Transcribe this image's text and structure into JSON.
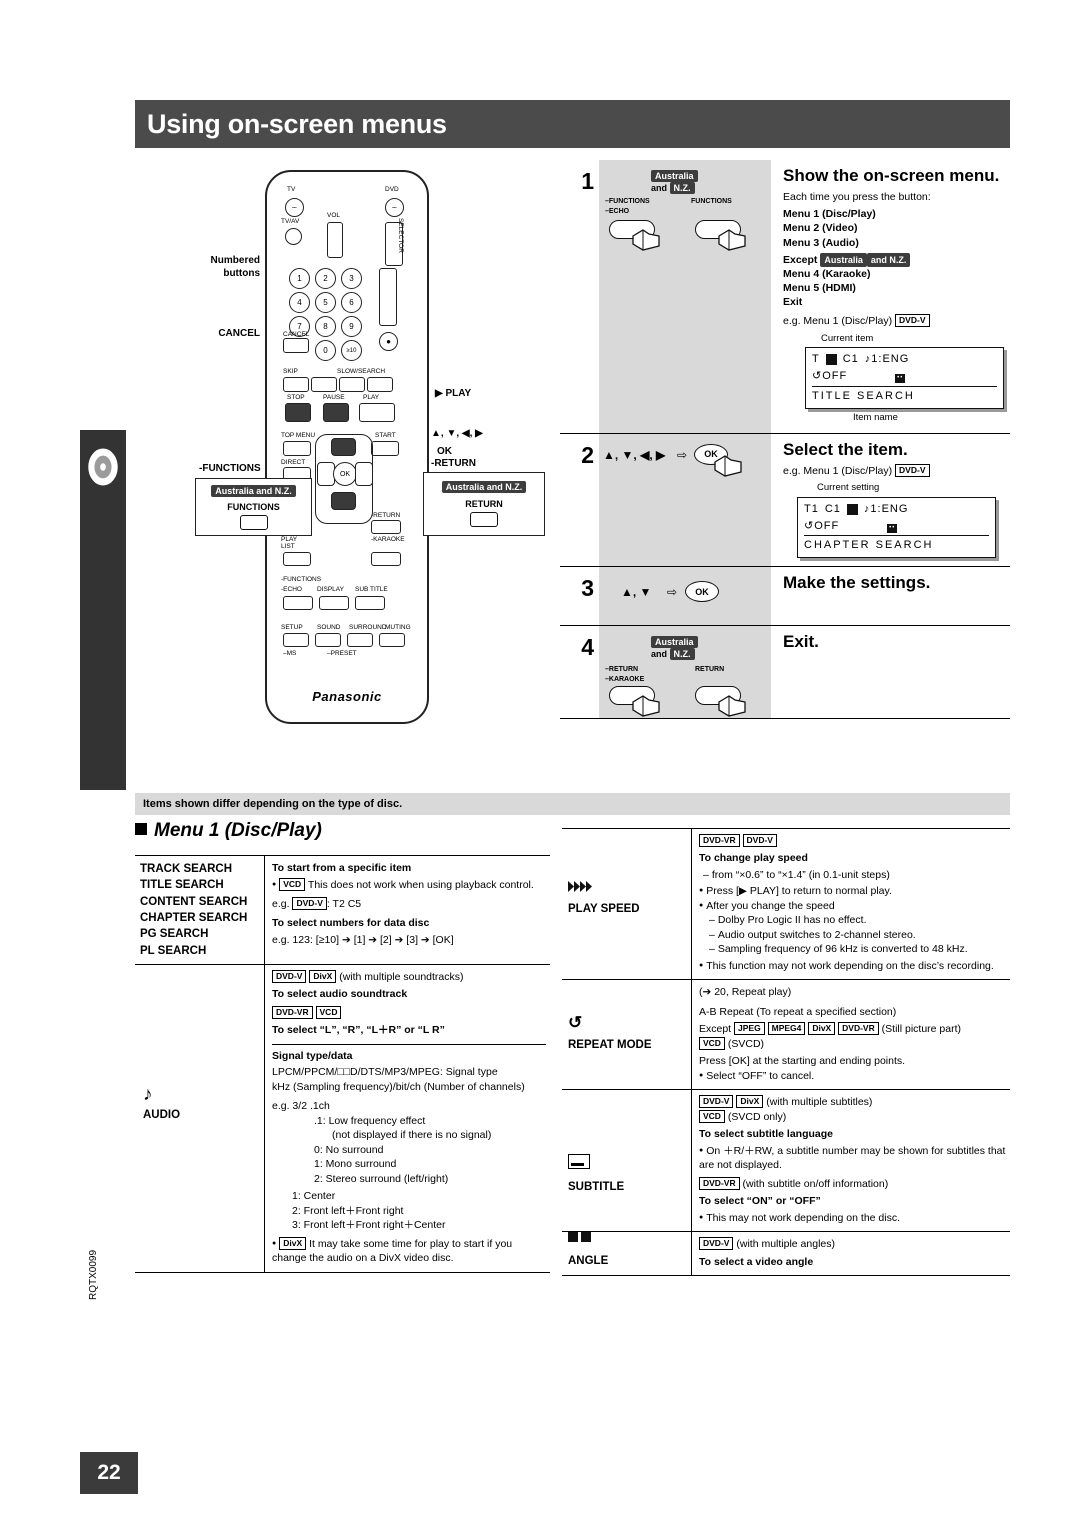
{
  "page": {
    "title": "Using on-screen menus",
    "side_tab_text": "Using on-screen menus",
    "page_number": "22",
    "doc_code": "RQTX0099"
  },
  "remote": {
    "labels": {
      "numbered_buttons": "Numbered\nbuttons",
      "cancel": "CANCEL",
      "play": "▶ PLAY",
      "arrows": "▲, ▼, ◀, ▶",
      "ok": "OK",
      "return": "-RETURN",
      "functions": "-FUNCTIONS",
      "brand": "Panasonic"
    },
    "callouts": {
      "functions_region": "Australia and N.Z.",
      "functions_button": "FUNCTIONS",
      "return_region": "Australia and N.Z.",
      "return_button": "RETURN"
    },
    "keys": {
      "tv": "TV",
      "dvd": "DVD",
      "tvav": "TV/AV",
      "vol": "VOL",
      "numbers": [
        "1",
        "2",
        "3",
        "4",
        "5",
        "6",
        "7",
        "8",
        "9",
        "0",
        "≥10"
      ],
      "cancel": "CANCEL",
      "skip": "SKIP",
      "slow_search": "SLOW/SEARCH",
      "stop": "STOP",
      "pause": "PAUSE",
      "play_key": "PLAY",
      "top_menu": "TOP MENU",
      "start": "START",
      "direct": "DIRECT",
      "menu": "MENU",
      "return_key": "RETURN",
      "play_list": "PLAY LIST",
      "karaoke": "KARAOKE",
      "functions_key": "-FUNCTIONS",
      "echo": "-ECHO",
      "setup": "SETUP",
      "sound": "SOUND",
      "surr": "SURROUND",
      "mute": "MUTING",
      "ms": "–MS",
      "preset": "–PRESET",
      "okc": "OK"
    }
  },
  "steps": [
    {
      "num": "1",
      "heading": "Show the on-screen menu.",
      "art": {
        "region_tag1": "Australia",
        "region_tag2": "and N.Z.",
        "left_label1": "–FUNCTIONS",
        "left_label2": "–ECHO",
        "right_label": "FUNCTIONS"
      },
      "body": {
        "lead": "Each time you press the button:",
        "items": [
          "Menu 1 (Disc/Play)",
          "Menu 2 (Video)",
          "Menu 3 (Audio)"
        ],
        "except_prefix": "Except",
        "except_tag1": "Australia",
        "except_tag2": "and N.Z.",
        "items2": [
          "Menu 4 (Karaoke)",
          "Menu 5 (HDMI)",
          "Exit"
        ],
        "eg": "e.g. Menu 1 (Disc/Play)",
        "eg_tag": "DVD-V",
        "caption_top": "Current item",
        "caption_bottom": "Item name",
        "osd": {
          "l1a": "T",
          "l1b": "C1",
          "l1c": "♪1:ENG",
          "l2": "↺OFF",
          "l3": "TITLE  SEARCH"
        }
      }
    },
    {
      "num": "2",
      "heading": "Select the item.",
      "art": {
        "keys": "▲, ▼, ◀, ▶",
        "arrow": "⇨",
        "ok": "OK"
      },
      "body": {
        "eg": "e.g. Menu 1 (Disc/Play)",
        "eg_tag": "DVD-V",
        "caption_top": "Current setting",
        "osd": {
          "l1a": "T1",
          "l1b": "C1",
          "l1c": "♪1:ENG",
          "l2": "↺OFF",
          "l3": "CHAPTER  SEARCH"
        }
      }
    },
    {
      "num": "3",
      "heading": "Make the settings.",
      "art": {
        "keys": "▲, ▼",
        "arrow": "⇨",
        "ok": "OK"
      }
    },
    {
      "num": "4",
      "heading": "Exit.",
      "art": {
        "region_tag1": "Australia",
        "region_tag2": "and N.Z.",
        "left_label1": "–RETURN",
        "left_label2": "–KARAOKE",
        "right_label": "RETURN"
      }
    }
  ],
  "note_bar": "Items shown differ depending on the type of disc.",
  "menu1_heading": "Menu 1 (Disc/Play)",
  "table_left": [
    {
      "name": "search",
      "labels": [
        "TRACK SEARCH",
        "TITLE SEARCH",
        "CONTENT SEARCH",
        "CHAPTER SEARCH",
        "PG SEARCH",
        "PL SEARCH"
      ],
      "lines": [
        {
          "type": "bold",
          "text": "To start from a specific item"
        },
        {
          "type": "bullet_tag",
          "tag": "VCD",
          "text": "This does not work when using playback control."
        },
        {
          "type": "eg_tag",
          "pre": "e.g.",
          "tag": "DVD-V",
          "text": ": T2 C5"
        },
        {
          "type": "bold",
          "text": "To select numbers for data disc"
        },
        {
          "type": "plain",
          "text": "e.g. 123: [≥10] ➔ [1] ➔ [2] ➔ [3] ➔ [OK]"
        }
      ]
    },
    {
      "name": "audio",
      "icon": "music-note",
      "labels": [
        "AUDIO"
      ],
      "lines": [
        {
          "type": "tags_text",
          "tags": [
            "DVD-V",
            "DivX"
          ],
          "text": "(with multiple soundtracks)"
        },
        {
          "type": "bold",
          "text": "To select audio soundtrack"
        },
        {
          "type": "tags_only",
          "tags": [
            "DVD-VR",
            "VCD"
          ]
        },
        {
          "type": "bold",
          "text": "To select “L”, “R”, “L＋R” or “L  R”"
        },
        {
          "type": "rule"
        },
        {
          "type": "bold",
          "text": "Signal type/data"
        },
        {
          "type": "plain",
          "text": "LPCM/PPCM/□□D/DTS/MP3/MPEG: Signal type"
        },
        {
          "type": "plain",
          "text": "kHz (Sampling frequency)/bit/ch (Number of channels)"
        },
        {
          "type": "eg_frac",
          "text": "e.g.   3/2 .1ch"
        },
        {
          "type": "indent",
          "text": ".1: Low frequency effect"
        },
        {
          "type": "indent2",
          "text": "(not displayed if there is no signal)"
        },
        {
          "type": "indent",
          "text": "0: No surround"
        },
        {
          "type": "indent",
          "text": "1: Mono surround"
        },
        {
          "type": "indent",
          "text": "2: Stereo surround (left/right)"
        },
        {
          "type": "indent3",
          "text": "1: Center"
        },
        {
          "type": "indent3",
          "text": "2: Front left＋Front right"
        },
        {
          "type": "indent3",
          "text": "3: Front left＋Front right＋Center"
        },
        {
          "type": "bullet_tag",
          "tag": "DivX",
          "text": "It may take some time for play to start if you change the audio on a DivX video disc."
        }
      ]
    }
  ],
  "table_right": [
    {
      "name": "play-speed",
      "icon": "speed",
      "labels": [
        "PLAY SPEED"
      ],
      "lines": [
        {
          "type": "tags_only",
          "tags": [
            "DVD-VR",
            "DVD-V"
          ]
        },
        {
          "type": "bold",
          "text": "To change play speed"
        },
        {
          "type": "dash",
          "text": "from “×0.6” to “×1.4” (in 0.1-unit steps)"
        },
        {
          "type": "bullet",
          "text": "Press [▶  PLAY] to return to normal play."
        },
        {
          "type": "bullet",
          "text": "After you change the speed"
        },
        {
          "type": "dash",
          "text": "Dolby Pro Logic II has no effect."
        },
        {
          "type": "dash",
          "text": "Audio output switches to 2-channel stereo."
        },
        {
          "type": "dash",
          "text": "Sampling frequency of 96 kHz is converted to 48 kHz."
        },
        {
          "type": "bullet",
          "text": "This function may not work depending on the disc’s recording."
        }
      ]
    },
    {
      "name": "repeat-mode",
      "icon": "repeat",
      "labels": [
        "REPEAT MODE"
      ],
      "lines": [
        {
          "type": "plain",
          "text": "(➔ 20, Repeat play)"
        },
        {
          "type": "plain_b",
          "text": "A-B Repeat (To repeat a specified section)"
        },
        {
          "type": "except_tags",
          "pre": "Except",
          "tags": [
            "JPEG",
            "MPEG4",
            "DivX",
            "DVD-VR"
          ],
          "post": "(Still picture part)"
        },
        {
          "type": "tag_post",
          "tags": [
            "VCD"
          ],
          "post": "(SVCD)"
        },
        {
          "type": "plain",
          "text": "Press [OK] at the starting and ending points."
        },
        {
          "type": "bullet",
          "text": "Select “OFF” to cancel."
        }
      ]
    },
    {
      "name": "subtitle",
      "icon": "subtitle",
      "labels": [
        "SUBTITLE"
      ],
      "lines": [
        {
          "type": "tags_text",
          "tags": [
            "DVD-V",
            "DivX"
          ],
          "text": "(with multiple subtitles)"
        },
        {
          "type": "tag_post",
          "tags": [
            "VCD"
          ],
          "post": "(SVCD only)"
        },
        {
          "type": "bold",
          "text": "To select subtitle language"
        },
        {
          "type": "bullet",
          "text": "On ＋R/＋RW, a subtitle number may be shown for subtitles that are not displayed."
        },
        {
          "type": "tags_text",
          "tags": [
            "DVD-VR"
          ],
          "text": "(with subtitle on/off information)"
        },
        {
          "type": "bold",
          "text": "To select “ON” or “OFF”"
        },
        {
          "type": "bullet",
          "text": "This may not work depending on the disc."
        }
      ]
    },
    {
      "name": "angle",
      "icon": "angle",
      "labels": [
        "ANGLE"
      ],
      "lines": [
        {
          "type": "tags_text",
          "tags": [
            "DVD-V"
          ],
          "text": "(with multiple angles)"
        },
        {
          "type": "bold",
          "text": "To select a video angle"
        }
      ]
    }
  ]
}
